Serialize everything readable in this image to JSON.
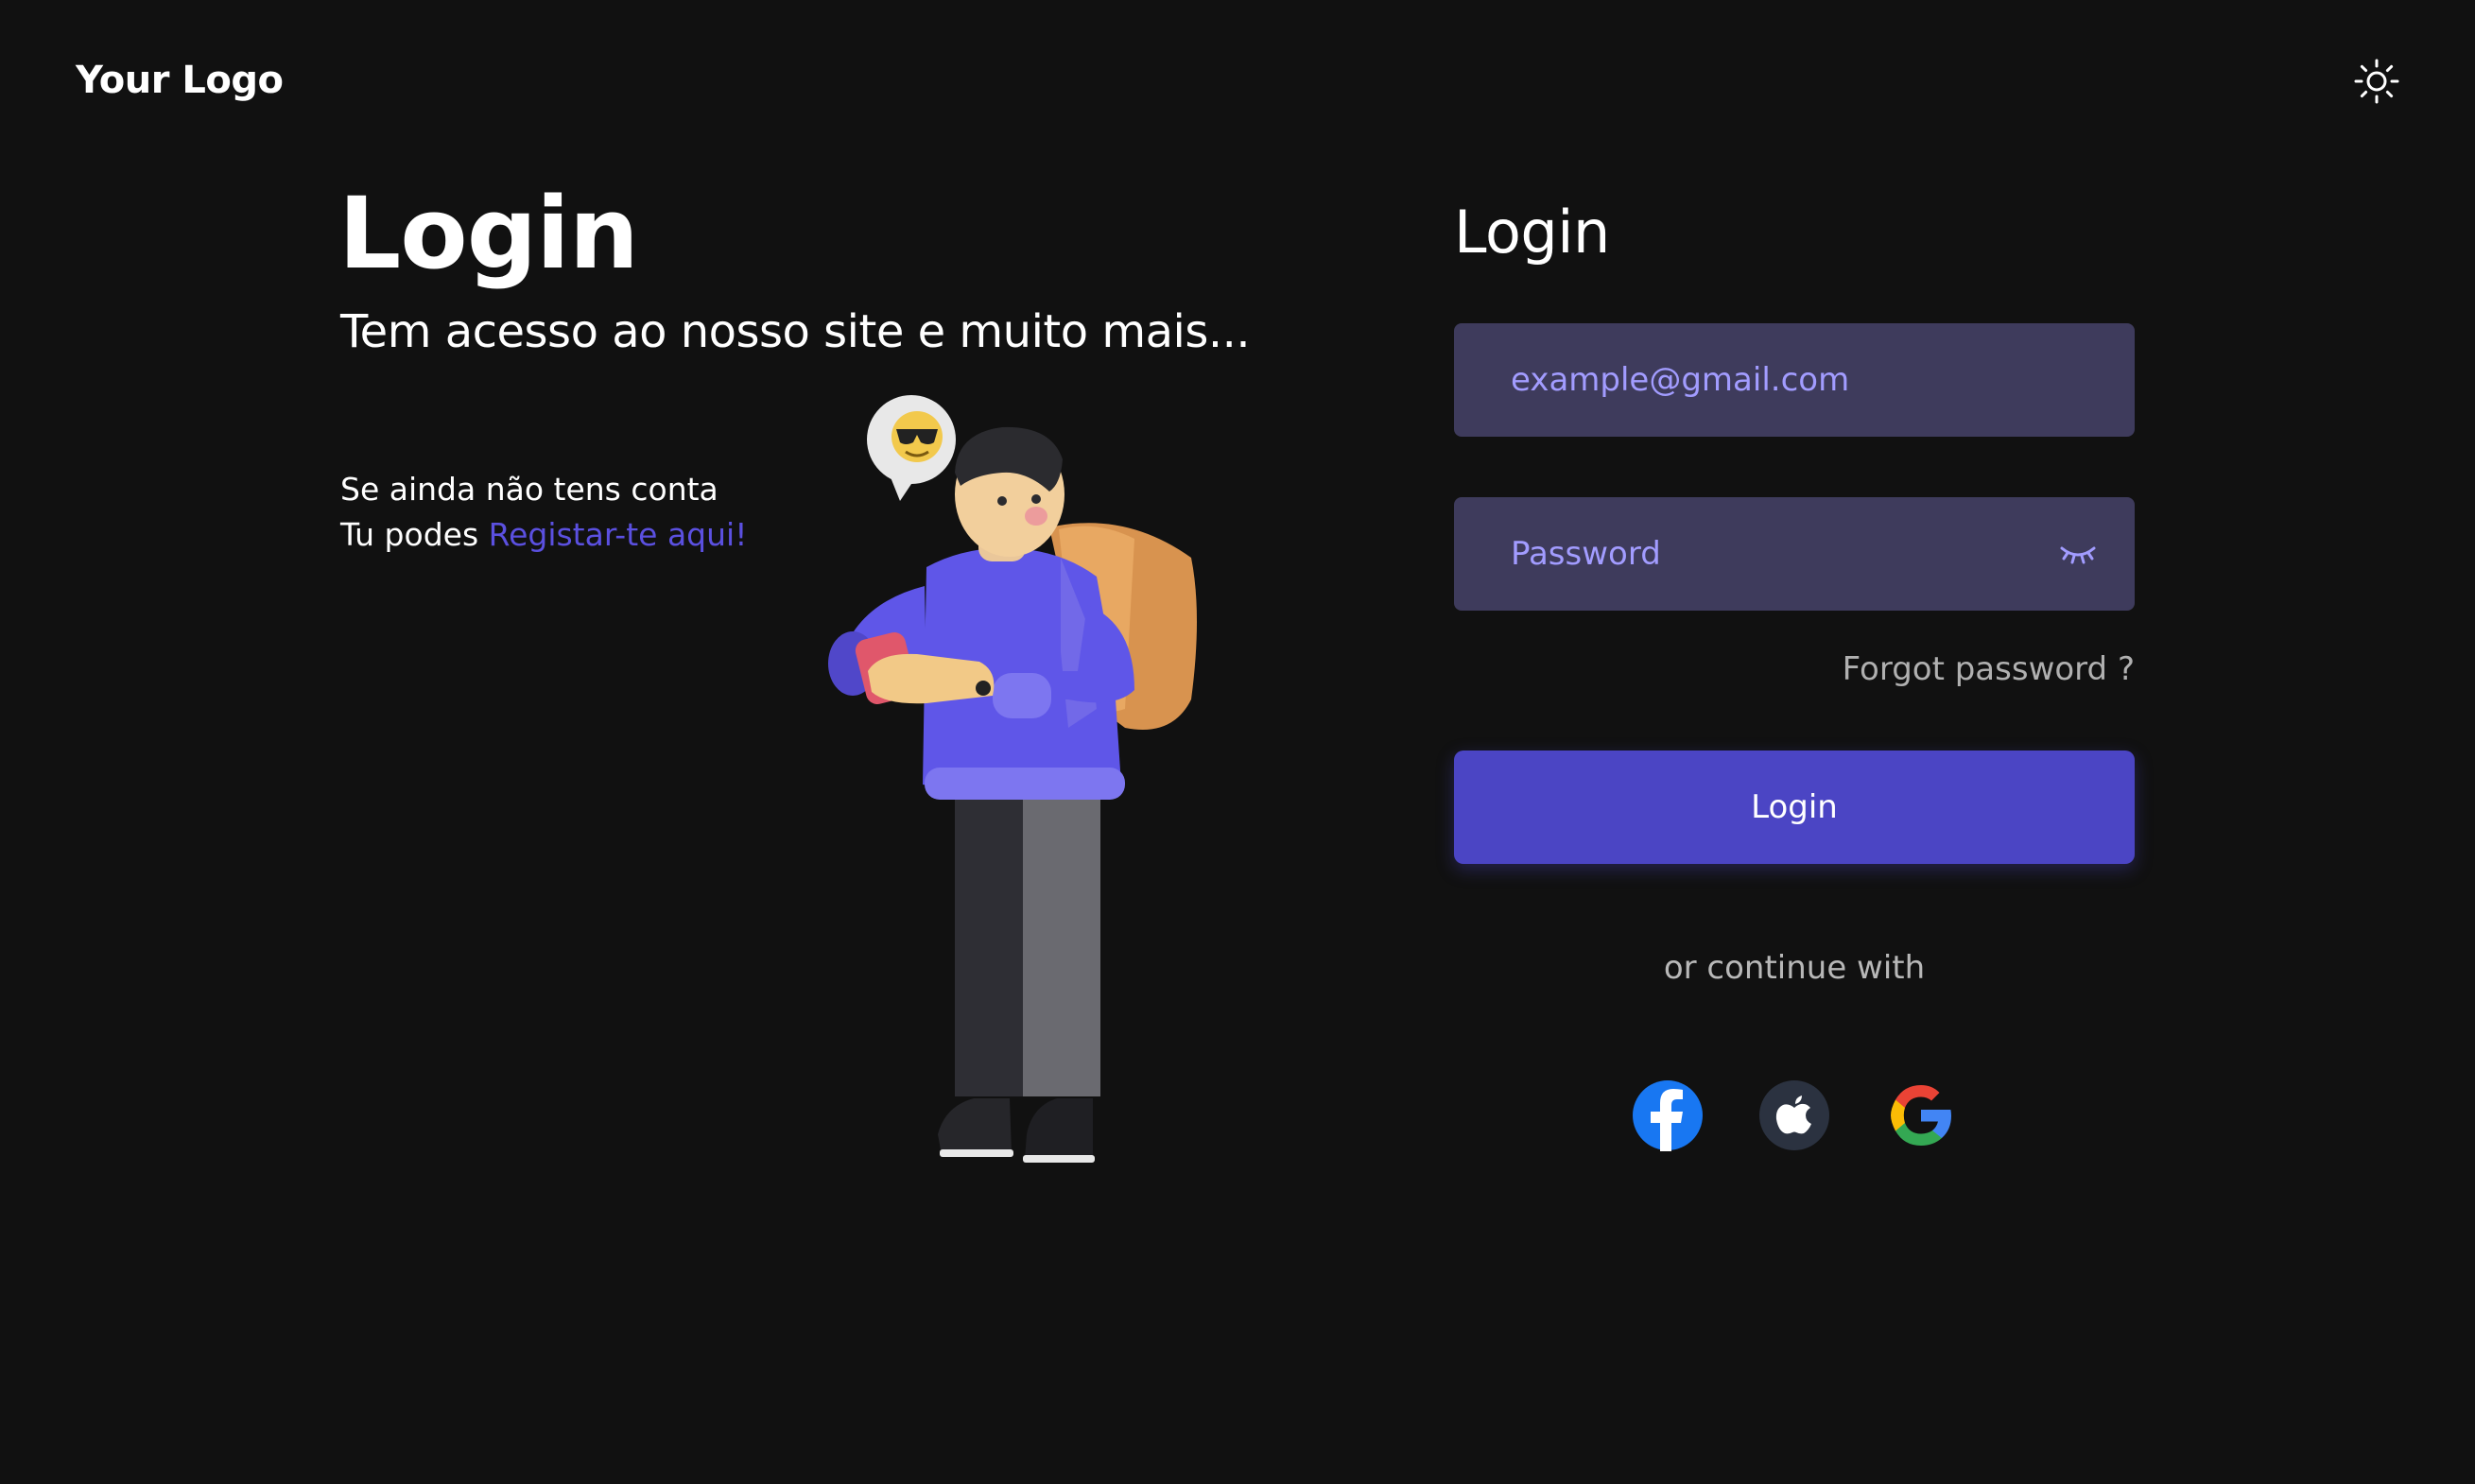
{
  "header": {
    "logo_text": "Your Logo",
    "theme_toggle_icon": "sun-icon"
  },
  "hero": {
    "title": "Login",
    "subtitle": "Tem acesso ao nosso site e muito mais...",
    "signup_line1": "Se ainda não tens conta",
    "signup_prefix": "Tu podes ",
    "signup_link": "Registar-te aqui!",
    "illustration": "person-with-phone-and-backpack",
    "accent_color": "#5b50e0"
  },
  "form": {
    "title": "Login",
    "email_placeholder": "example@gmail.com",
    "password_placeholder": "Password",
    "password_toggle_icon": "eye-closed-icon",
    "forgot_link": "Forgot password ?",
    "submit_label": "Login",
    "divider_text": "or continue with",
    "field_bg": "#3e3b5c",
    "button_bg": "#4b45c4"
  },
  "social": [
    {
      "name": "Facebook",
      "icon": "facebook-icon"
    },
    {
      "name": "Apple",
      "icon": "apple-icon"
    },
    {
      "name": "Google",
      "icon": "google-icon"
    }
  ]
}
